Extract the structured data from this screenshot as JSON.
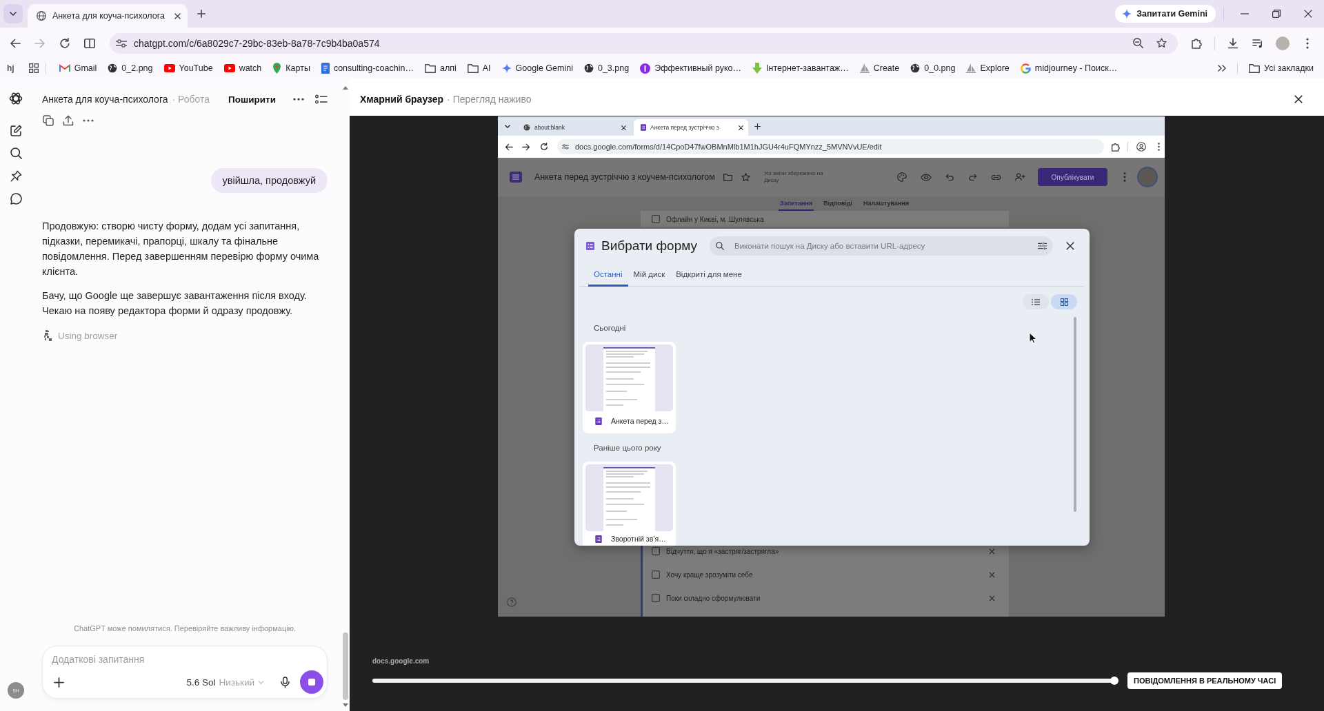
{
  "browser": {
    "tabs": [
      {
        "title": "Анкета для коуча-психолога",
        "selected": true
      }
    ],
    "gemini_button": "Запитати Gemini",
    "can_go_forward": false,
    "address": "chatgpt.com/c/6a8029c7-29bc-83eb-8a78-7c9b4ba0a574"
  },
  "bookmarks_bar": {
    "shortcut": "hj",
    "items": [
      {
        "label": "Gmail",
        "kind": "mail"
      },
      {
        "label": "0_2.png",
        "kind": "globe"
      },
      {
        "label": "YouTube",
        "kind": "video"
      },
      {
        "label": "watch",
        "kind": "video"
      },
      {
        "label": "Карты",
        "kind": "map"
      },
      {
        "label": "consulting-coachin…",
        "kind": "doc"
      },
      {
        "label": "алпі",
        "kind": "folder"
      },
      {
        "label": "AI",
        "kind": "folder"
      },
      {
        "label": "Google Gemini",
        "kind": "sparkle"
      },
      {
        "label": "0_3.png",
        "kind": "globe"
      },
      {
        "label": "Эффективный руко…",
        "kind": "badge"
      },
      {
        "label": "Інтернет-завантаж…",
        "kind": "download"
      },
      {
        "label": "Create",
        "kind": "sail"
      },
      {
        "label": "0_0.png",
        "kind": "globe"
      },
      {
        "label": "Explore",
        "kind": "sail"
      },
      {
        "label": "midjourney - Поиск…",
        "kind": "search"
      }
    ],
    "all_bookmarks": "Усі закладки"
  },
  "chat": {
    "title": "Анкета для коуча-психолога",
    "project": "· Робота",
    "share": "Поширити",
    "messages": [
      {
        "kind": "user",
        "text": "увійшла, продовжуй"
      },
      {
        "kind": "assistant",
        "paragraphs": [
          "Продовжую: створю чисту форму, додам усі запитання, підказки, перемикачі, прапорці, шкалу та фінальне повідомлення. Перед завершенням перевірю форму очима клієнта.",
          "Бачу, що Google ще завершує завантаження після входу. Чекаю на появу редактора форми й одразу продовжу."
        ]
      }
    ],
    "activity": "Using browser",
    "disclaimer": "ChatGPT може помилятися. Перевіряйте важливу інформацію.",
    "composer": {
      "placeholder": "Додаткові запитання",
      "model": "5.6 Sol",
      "effort": "Низький"
    },
    "avatar": "SH"
  },
  "viewer": {
    "title": "Хмарний браузер",
    "subtitle": "· Перегляд наживо",
    "remote": {
      "tabs": [
        {
          "title": "about:blank",
          "selected": false
        },
        {
          "title": "Анкета перед зустріччю з",
          "selected": true
        }
      ],
      "address": "docs.google.com/forms/d/14CpoD47fwOBMnMlb1M1hJGU4r4uFQMYnzz_5MVNVvUE/edit",
      "form": {
        "title": "Анкета перед зустріччю з коучем-психологом",
        "save_status": "Усі зміни збережено на Диску",
        "publish": "Опублікувати",
        "tabs": [
          {
            "label": "Запитання",
            "selected": true
          },
          {
            "label": "Відповіді",
            "selected": false
          },
          {
            "label": "Налаштування",
            "selected": false
          }
        ],
        "upper_options": [
          "Офлайн у Києві, м. Шулявська"
        ],
        "lower_options": [
          "Відчуття, що я «застряг/застрягла»",
          "Хочу краще зрозуміти себе",
          "Поки складно сформулювати"
        ]
      },
      "dialog": {
        "title": "Вибрати форму",
        "search": {
          "placeholder": "Виконати пошук на Диску або вставити URL-адресу"
        },
        "tabs": [
          {
            "label": "Останні",
            "selected": true
          },
          {
            "label": "Мій диск",
            "selected": false
          },
          {
            "label": "Відкриті для мене",
            "selected": false
          }
        ],
        "views": [
          {
            "kind": "list",
            "selected": false
          },
          {
            "kind": "grid",
            "selected": true
          }
        ],
        "sections": [
          {
            "heading": "Сьогодні",
            "files": [
              {
                "name": "Анкета перед з…"
              }
            ]
          },
          {
            "heading": "Раніше цього року",
            "files": [
              {
                "name": "Зворотній зв’я…"
              }
            ]
          }
        ]
      }
    },
    "source": "docs.google.com",
    "progress": {
      "level": 1
    },
    "live_button": "ПОВІДОМЛЕННЯ В РЕАЛЬНОМУ ЧАСІ"
  }
}
